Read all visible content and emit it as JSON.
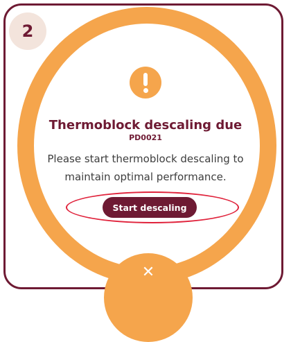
{
  "step_badge": "2",
  "icon": "exclamation-icon",
  "title": "Thermoblock descaling due",
  "code": "PD0021",
  "message": "Please start thermoblock descaling to maintain optimal performance.",
  "start_button": "Start descaling",
  "close_glyph": "✕",
  "colors": {
    "brand": "#6e1a33",
    "accent": "#f5a54c",
    "highlight": "#e0223b"
  }
}
